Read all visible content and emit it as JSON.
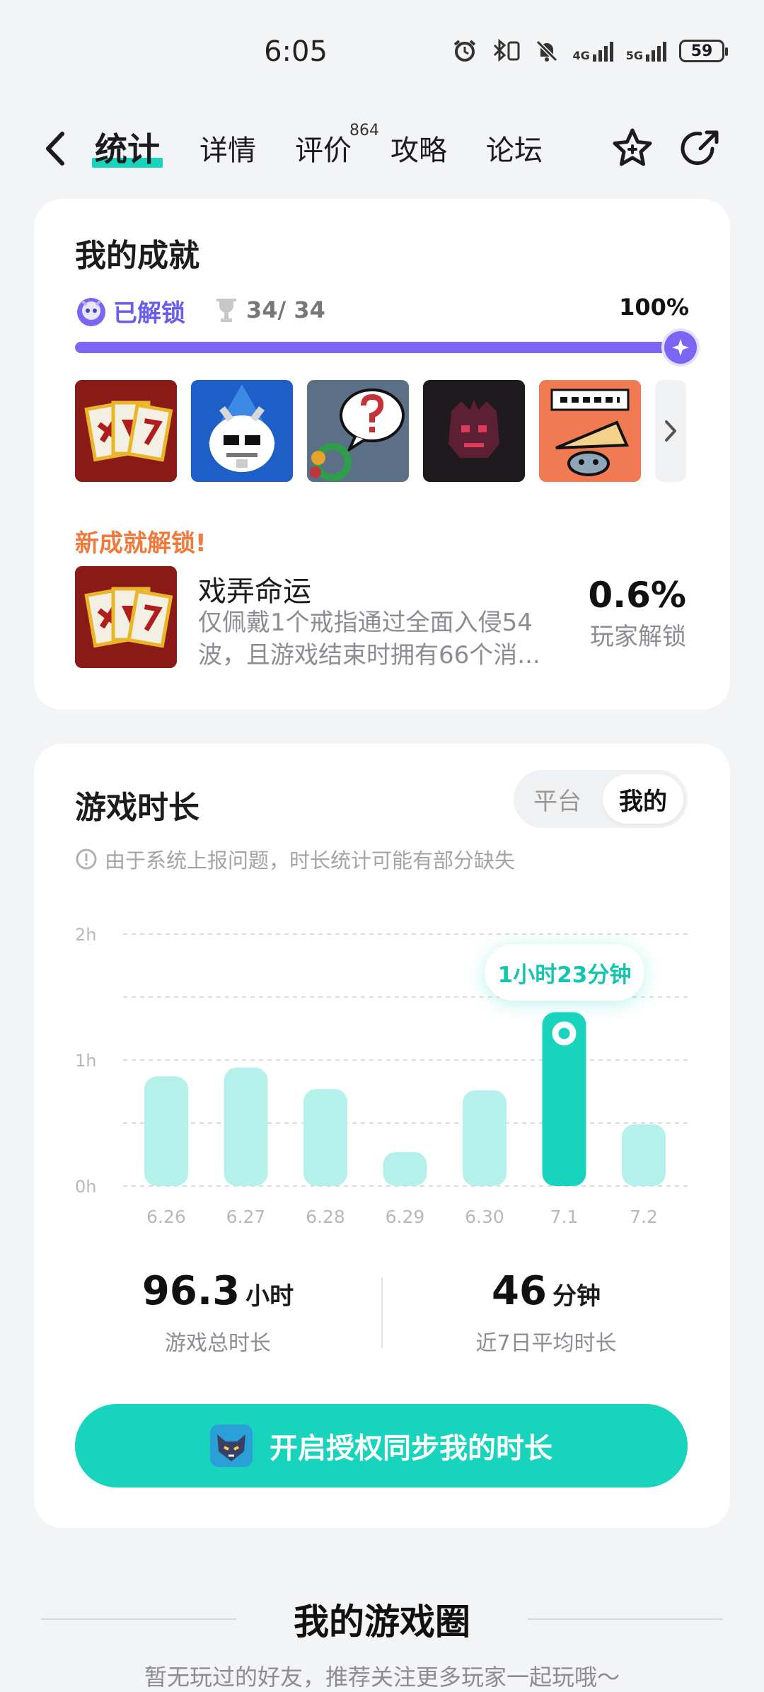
{
  "status_bar": {
    "time": "6:05",
    "signal1_label": "4G",
    "signal2_label": "5G",
    "battery": "59"
  },
  "nav": {
    "tabs": [
      {
        "label": "统计",
        "active": true
      },
      {
        "label": "详情",
        "active": false
      },
      {
        "label": "评价",
        "active": false,
        "badge": "864"
      },
      {
        "label": "攻略",
        "active": false
      },
      {
        "label": "论坛",
        "active": false
      }
    ],
    "icons": [
      "back-icon",
      "star-add-icon",
      "share-icon"
    ]
  },
  "achievements": {
    "title": "我的成就",
    "unlocked_label": "已解锁",
    "count": "34/ 34",
    "percent_text": "100%",
    "progress": 1.0,
    "thumbnails": [
      "cards-icon",
      "skull-wizard-icon",
      "question-bubble-icon",
      "demon-icon",
      "bonk-icon"
    ],
    "new_unlock_label": "新成就解锁!",
    "latest": {
      "name": "戏弄命运",
      "description_line1": "仅佩戴1个戒指通过全面入侵54",
      "description_line2": "波，且游戏结束时拥有66个消...",
      "percent": "0.6%",
      "percent_label": "玩家解锁"
    }
  },
  "playtime": {
    "title": "游戏时长",
    "toggle": {
      "platform": "平台",
      "mine": "我的",
      "selected": "mine"
    },
    "notice": "由于系统上报问题，时长统计可能有部分缺失",
    "total_value": "96.3",
    "total_unit": "小时",
    "total_label": "游戏总时长",
    "avg_value": "46",
    "avg_unit": "分钟",
    "avg_label": "近7日平均时长",
    "sync_button": "开启授权同步我的时长"
  },
  "chart_data": {
    "type": "bar",
    "categories": [
      "6.26",
      "6.27",
      "6.28",
      "6.29",
      "6.30",
      "7.1",
      "7.2"
    ],
    "values": [
      0.87,
      0.94,
      0.77,
      0.27,
      0.76,
      1.38,
      0.49
    ],
    "y_ticks": [
      "0h",
      "1h",
      "2h"
    ],
    "ylim": [
      0,
      2
    ],
    "highlight_index": 5,
    "highlight_label": "1小时23分钟",
    "colors": {
      "bar": "#b4f1ea",
      "highlight": "#18d4bd",
      "grid": "#dcdce0",
      "tick": "#b8b8bc"
    }
  },
  "game_circle": {
    "title": "我的游戏圈",
    "subtitle": "暂无玩过的好友，推荐关注更多玩家一起玩哦～"
  },
  "colors": {
    "accent": "#18d4bd",
    "achievement_purple": "#7a66f2",
    "new_unlock_orange": "#f07a3c"
  }
}
